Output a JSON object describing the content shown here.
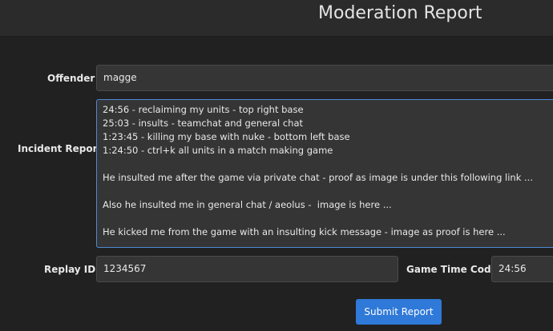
{
  "header": {
    "title": "Moderation Report"
  },
  "form": {
    "offender": {
      "label": "Offender",
      "value": "magge"
    },
    "incident_report": {
      "label": "Incident Report",
      "value": "24:56 - reclaiming my units - top right base\n25:03 - insults - teamchat and general chat\n1:23:45 - killing my base with nuke - bottom left base\n1:24:50 - ctrl+k all units in a match making game\n\nHe insulted me after the game via private chat - proof as image is under this following link ...\n\nAlso he insulted me in general chat / aeolus -  image is here ...\n\nHe kicked me from the game with an insulting kick message - image as proof is here ..."
    },
    "replay_id": {
      "label": "Replay ID",
      "value": "1234567"
    },
    "game_time_code": {
      "label": "Game Time Code",
      "value": "24:56"
    },
    "submit_label": "Submit Report"
  },
  "colors": {
    "background": "#212121",
    "header": "#2b2b2b",
    "field": "#353535",
    "focus_border": "#4f89d6",
    "button": "#2f79d8"
  }
}
